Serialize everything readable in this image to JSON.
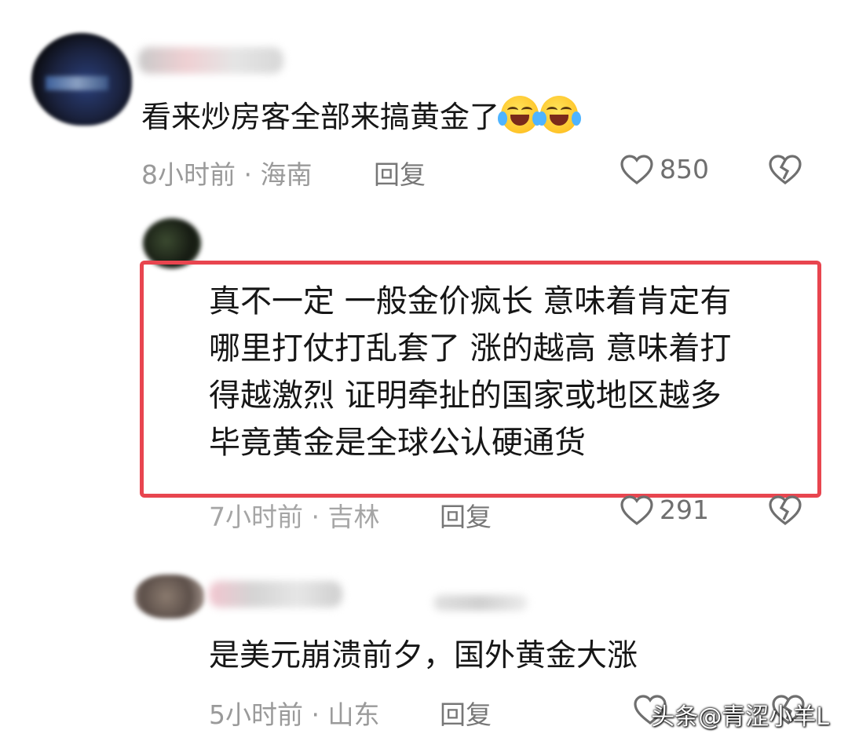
{
  "comments": [
    {
      "text": "看来炒房客全部来搞黄金了",
      "emojis": [
        "laughing-tears-emoji",
        "laughing-tears-emoji"
      ],
      "time": "8小时前",
      "region": "海南",
      "reply_label": "回复",
      "likes": "850"
    },
    {
      "lines": [
        "真不一定 一般金价疯长 意味着肯定有",
        "哪里打仗打乱套了 涨的越高 意味着打",
        "得越激烈 证明牵扯的国家或地区越多",
        "毕竟黄金是全球公认硬通货"
      ],
      "time": "7小时前",
      "region": "吉林",
      "reply_label": "回复",
      "likes": "291"
    },
    {
      "text": "是美元崩溃前夕，国外黄金大涨",
      "time": "5小时前",
      "region": "山东",
      "reply_label": "回复"
    }
  ],
  "separator": "·",
  "watermark": "头条@青涩小羊L",
  "colors": {
    "highlight_border": "#e8454f",
    "meta_text": "#9a9a9a",
    "body_text": "#161616"
  }
}
